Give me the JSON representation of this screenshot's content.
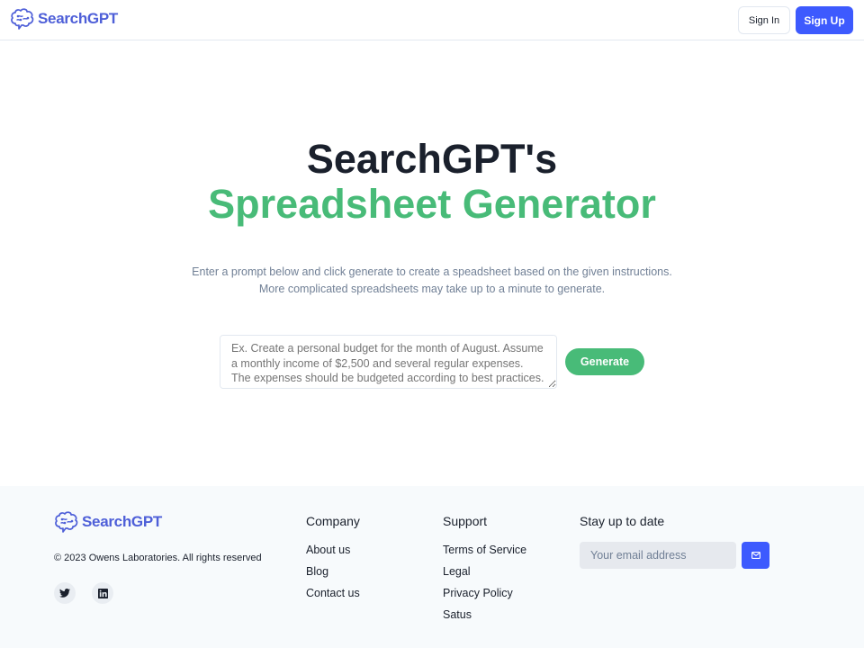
{
  "header": {
    "logo_text": "SearchGPT",
    "sign_in_label": "Sign In",
    "sign_up_label": "Sign Up"
  },
  "hero": {
    "title_line1": "SearchGPT's",
    "title_line2": "Spreadsheet Generator",
    "description": "Enter a prompt below and click generate to create a speadsheet based on the given instructions. More complicated spreadsheets may take up to a minute to generate.",
    "prompt_placeholder": "Ex. Create a personal budget for the month of August. Assume a monthly income of $2,500 and several regular expenses. The expenses should be budgeted according to best practices.",
    "prompt_value": "",
    "generate_label": "Generate"
  },
  "footer": {
    "logo_text": "SearchGPT",
    "copyright": "© 2023 Owens Laboratories. All rights reserved",
    "social": [
      {
        "icon": "twitter-icon"
      },
      {
        "icon": "linkedin-icon"
      }
    ],
    "company": {
      "title": "Company",
      "links": [
        "About us",
        "Blog",
        "Contact us"
      ]
    },
    "support": {
      "title": "Support",
      "links": [
        "Terms of Service",
        "Legal",
        "Privacy Policy",
        "Satus"
      ]
    },
    "newsletter": {
      "title": "Stay up to date",
      "email_placeholder": "Your email address",
      "email_value": "",
      "submit_icon": "mail-icon"
    }
  },
  "colors": {
    "brand_blue": "#3d5afe",
    "logo_blue": "#4e5fd8",
    "accent_green": "#48bb78",
    "text_dark": "#1a202c",
    "text_muted": "#718096",
    "footer_bg": "#f7fafc"
  }
}
